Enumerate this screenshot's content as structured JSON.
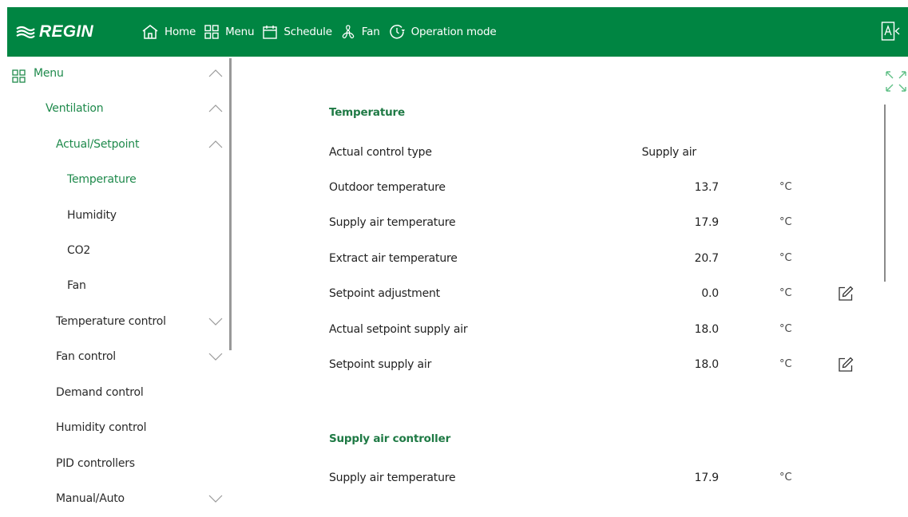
{
  "app": {
    "logo": "REGIN",
    "brand_color": "#008542",
    "accent_green": "#1f8a4c"
  },
  "topnav": [
    {
      "label": "Home",
      "icon": "home-icon"
    },
    {
      "label": "Menu",
      "icon": "grid-icon"
    },
    {
      "label": "Schedule",
      "icon": "calendar-icon"
    },
    {
      "label": "Fan",
      "icon": "fan-icon"
    },
    {
      "label": "Operation mode",
      "icon": "operation-mode-icon"
    }
  ],
  "sidebar": {
    "items": [
      {
        "label": "Menu",
        "state": "expanded",
        "active": true
      },
      {
        "label": "Ventilation",
        "state": "expanded",
        "active": true
      },
      {
        "label": "Actual/Setpoint",
        "state": "expanded",
        "active": true
      },
      {
        "label": "Temperature",
        "state": "leaf",
        "active": true
      },
      {
        "label": "Humidity",
        "state": "leaf",
        "active": false
      },
      {
        "label": "CO2",
        "state": "leaf",
        "active": false
      },
      {
        "label": "Fan",
        "state": "leaf",
        "active": false
      },
      {
        "label": "Temperature control",
        "state": "collapsed",
        "active": false
      },
      {
        "label": "Fan control",
        "state": "collapsed",
        "active": false
      },
      {
        "label": "Demand control",
        "state": "leaf",
        "active": false
      },
      {
        "label": "Humidity control",
        "state": "leaf",
        "active": false
      },
      {
        "label": "PID controllers",
        "state": "leaf",
        "active": false
      },
      {
        "label": "Manual/Auto",
        "state": "collapsed",
        "active": false
      }
    ]
  },
  "main": {
    "sections": [
      {
        "title": "Temperature",
        "rows": [
          {
            "label": "Actual control type",
            "value": "Supply air",
            "unit": "",
            "editable": false
          },
          {
            "label": "Outdoor temperature",
            "value": "13.7",
            "unit": "°C",
            "editable": false
          },
          {
            "label": "Supply air temperature",
            "value": "17.9",
            "unit": "°C",
            "editable": false
          },
          {
            "label": "Extract air temperature",
            "value": "20.7",
            "unit": "°C",
            "editable": false
          },
          {
            "label": "Setpoint adjustment",
            "value": "0.0",
            "unit": "°C",
            "editable": true
          },
          {
            "label": "Actual setpoint supply air",
            "value": "18.0",
            "unit": "°C",
            "editable": false
          },
          {
            "label": "Setpoint supply air",
            "value": "18.0",
            "unit": "°C",
            "editable": true
          }
        ]
      },
      {
        "title": "Supply air controller",
        "rows": [
          {
            "label": "Supply air temperature",
            "value": "17.9",
            "unit": "°C",
            "editable": false
          }
        ]
      }
    ]
  }
}
